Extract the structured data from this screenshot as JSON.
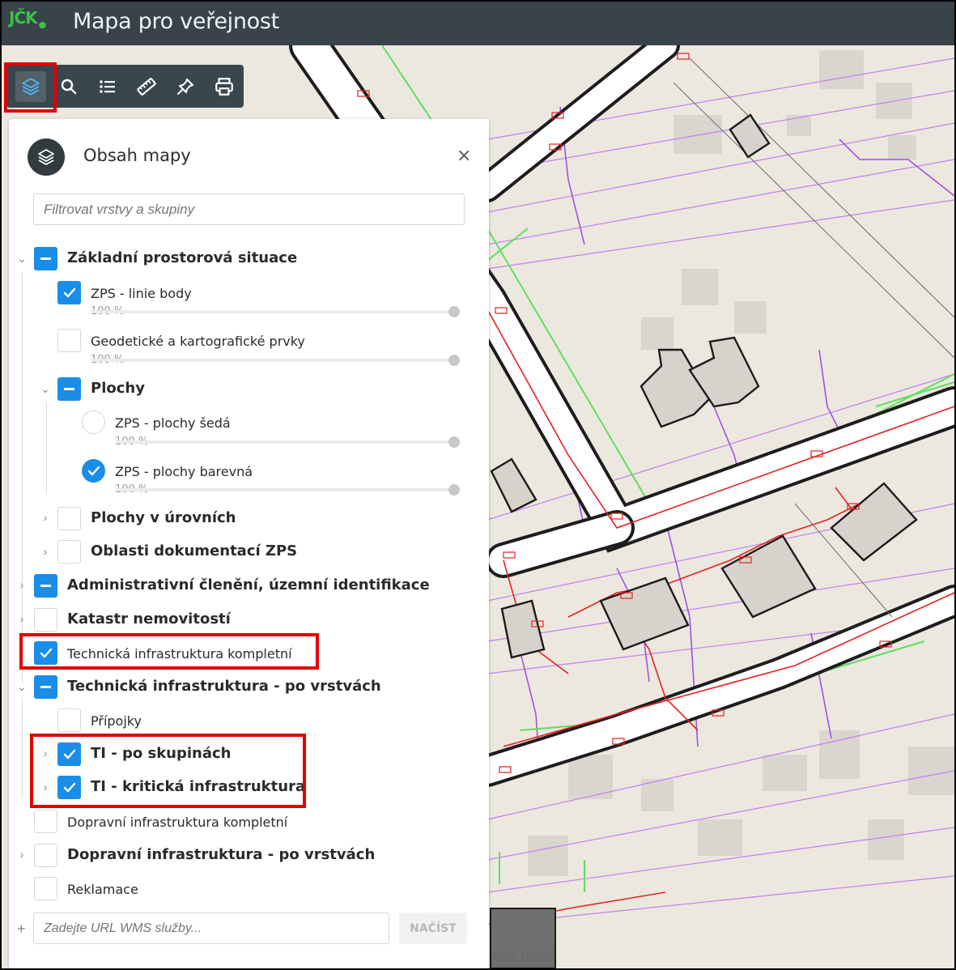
{
  "app": {
    "logo": "JČK",
    "title": "Mapa pro veřejnost"
  },
  "toolbar": {
    "tools": [
      {
        "icon": "layers-icon",
        "active": true
      },
      {
        "icon": "search-icon"
      },
      {
        "icon": "legend-list-icon"
      },
      {
        "icon": "ruler-icon"
      },
      {
        "icon": "pin-icon"
      },
      {
        "icon": "print-icon"
      }
    ]
  },
  "panel": {
    "title": "Obsah mapy",
    "close": "×",
    "filter_placeholder": "Filtrovat vrstvy a skupiny",
    "items": [
      {
        "label": "Základní prostorová situace",
        "type": "group",
        "state": "indeterminate",
        "expanded": true
      },
      {
        "label": "ZPS - linie body",
        "type": "layer",
        "state": "checked",
        "opacity": "100 %"
      },
      {
        "label": "Geodetické a kartografické prvky",
        "type": "layer",
        "state": "unchecked",
        "opacity": "100 %"
      },
      {
        "label": "Plochy",
        "type": "group",
        "state": "indeterminate",
        "expanded": true
      },
      {
        "label": "ZPS - plochy šedá",
        "type": "radio",
        "state": "unchecked",
        "opacity": "100 %"
      },
      {
        "label": "ZPS - plochy barevná",
        "type": "radio",
        "state": "checked",
        "opacity": "100 %"
      },
      {
        "label": "Plochy v úrovních",
        "type": "group",
        "state": "unchecked",
        "expanded": false
      },
      {
        "label": "Oblasti dokumentací ZPS",
        "type": "group",
        "state": "unchecked",
        "expanded": false
      },
      {
        "label": "Administrativní členění, územní identifikace",
        "type": "group",
        "state": "indeterminate",
        "expanded": false
      },
      {
        "label": "Katastr nemovitostí",
        "type": "group",
        "state": "unchecked",
        "expanded": false
      },
      {
        "label": "Technická infrastruktura kompletní",
        "type": "layer",
        "state": "checked"
      },
      {
        "label": "Technická infrastruktura - po vrstvách",
        "type": "group",
        "state": "indeterminate",
        "expanded": true
      },
      {
        "label": "Přípojky",
        "type": "layer",
        "state": "unchecked"
      },
      {
        "label": "TI - po skupinách",
        "type": "group",
        "state": "checked",
        "expanded": false
      },
      {
        "label": "TI - kritická infrastruktura",
        "type": "group",
        "state": "checked",
        "expanded": false
      },
      {
        "label": "Dopravní infrastruktura kompletní",
        "type": "layer",
        "state": "unchecked"
      },
      {
        "label": "Dopravní infrastruktura - po vrstvách",
        "type": "group",
        "state": "unchecked",
        "expanded": false
      },
      {
        "label": "Reklamace",
        "type": "layer",
        "state": "unchecked"
      }
    ],
    "wms_placeholder": "Zadejte URL WMS služby...",
    "wms_button": "NAČÍST",
    "wms_add": "+"
  },
  "map": {
    "visible_label": "ční úřad"
  },
  "colors": {
    "accent": "#1a8de8",
    "header": "#38434a",
    "highlight": "#e00000"
  }
}
